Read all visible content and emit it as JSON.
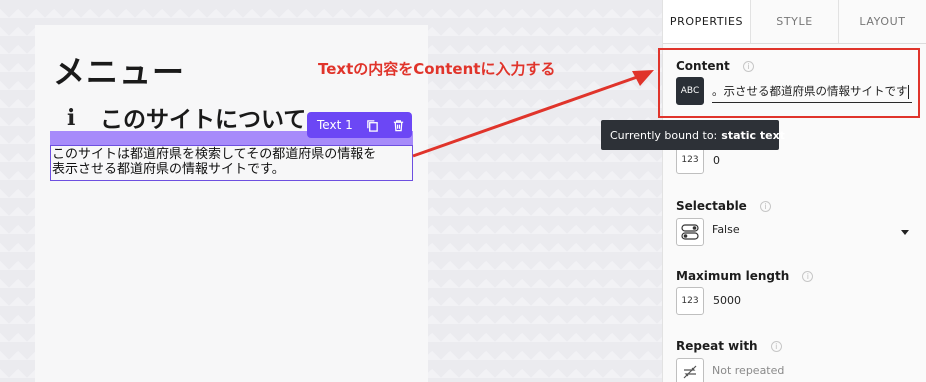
{
  "canvas": {
    "page_title": "メニュー",
    "section_title": "このサイトについて",
    "info_glyph": "i",
    "selected_text": "このサイトは都道府県を検索してその都道府県の情報を\n表示させる都道府県の情報サイトです。",
    "component_chip": {
      "label": "Text 1",
      "copy_icon": "copy-icon",
      "delete_icon": "trash-icon"
    }
  },
  "annotation": {
    "text": "Textの内容をContentに入力する",
    "color": "#e0342b"
  },
  "panel": {
    "tabs": [
      {
        "label": "PROPERTIES",
        "active": true
      },
      {
        "label": "STYLE",
        "active": false
      },
      {
        "label": "LAYOUT",
        "active": false
      }
    ],
    "content": {
      "label": "Content",
      "type_badge": "ABC",
      "value": "表示させる都道府県の情報サイトです。",
      "visible_value": "示させる都道府県の情報サイトです。"
    },
    "tooltip": {
      "prefix": "Currently bound to:",
      "value": "static text"
    },
    "number_field": {
      "type_badge": "123",
      "value": "0"
    },
    "selectable": {
      "label": "Selectable",
      "value": "False"
    },
    "maximum_length": {
      "label": "Maximum length",
      "type_badge": "123",
      "value": "5000"
    },
    "repeat_with": {
      "label": "Repeat with",
      "value": "Not repeated"
    }
  },
  "colors": {
    "accent": "#6c47f5",
    "highlight_band": "#a78bfa",
    "annotation_red": "#e0342b",
    "tooltip_bg": "#2d3137"
  }
}
